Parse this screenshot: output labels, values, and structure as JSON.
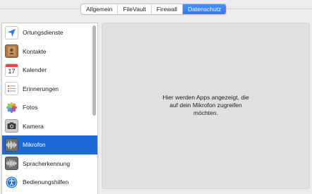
{
  "tabs": [
    {
      "label": "Allgemein",
      "active": false
    },
    {
      "label": "FileVault",
      "active": false
    },
    {
      "label": "Firewall",
      "active": false
    },
    {
      "label": "Datenschutz",
      "active": true
    }
  ],
  "sidebar": {
    "items": [
      {
        "label": "Ortungsdienste",
        "icon": "location-arrow-icon"
      },
      {
        "label": "Kontakte",
        "icon": "contacts-book-icon"
      },
      {
        "label": "Kalender",
        "icon": "calendar-icon",
        "icon_text": "17"
      },
      {
        "label": "Erinnerungen",
        "icon": "reminders-icon"
      },
      {
        "label": "Fotos",
        "icon": "photos-flower-icon"
      },
      {
        "label": "Kamera",
        "icon": "camera-icon"
      },
      {
        "label": "Mikrofon",
        "icon": "microphone-waveform-icon",
        "selected": true
      },
      {
        "label": "Spracherkennung",
        "icon": "speech-waveform-icon"
      },
      {
        "label": "Bedienungshilfen",
        "icon": "accessibility-icon"
      }
    ]
  },
  "detail": {
    "message_lines": [
      "Hier werden Apps angezeigt, die",
      "auf dein Mikrofon zugreifen",
      "möchten."
    ]
  },
  "colors": {
    "accent": "#1c6ad7",
    "tab_active": "#2f79f0",
    "background": "#ececec",
    "detail_bg": "#e1e1e1"
  }
}
